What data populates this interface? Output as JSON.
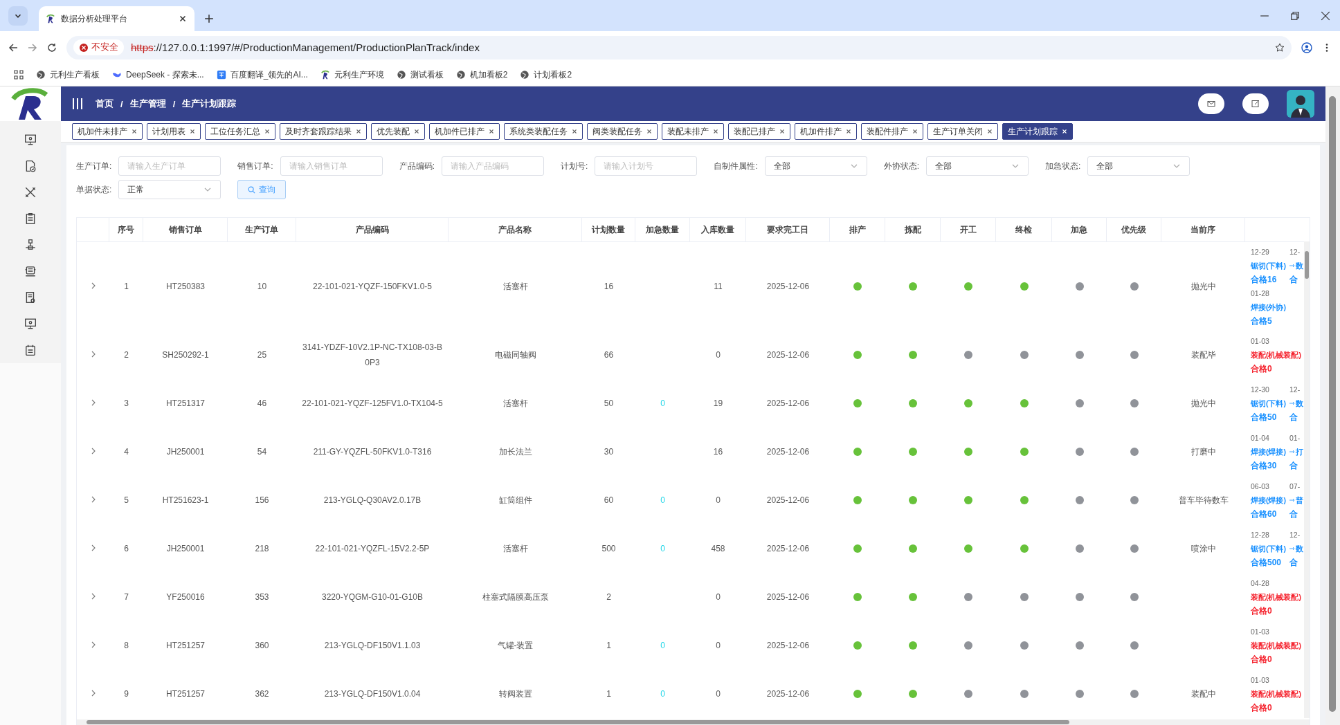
{
  "browser": {
    "tab_title": "数据分析处理平台",
    "insecure_label": "不安全",
    "url_scheme": "https",
    "url_rest": "://127.0.0.1:1997/#/ProductionManagement/ProductionPlanTrack/index",
    "bookmarks": [
      {
        "label": "元利生产看板",
        "kind": "globe"
      },
      {
        "label": "DeepSeek - 探索未...",
        "kind": "whale"
      },
      {
        "label": "百度翻译_领先的AI...",
        "kind": "translate"
      },
      {
        "label": "元利生产环境",
        "kind": "logo"
      },
      {
        "label": "测试看板",
        "kind": "globe"
      },
      {
        "label": "机加看板2",
        "kind": "globe"
      },
      {
        "label": "计划看板2",
        "kind": "globe"
      }
    ]
  },
  "sidebar": [
    {
      "kind": "monitor"
    },
    {
      "kind": "doc-check"
    },
    {
      "kind": "tools"
    },
    {
      "kind": "clipboard"
    },
    {
      "kind": "network"
    },
    {
      "kind": "machine"
    },
    {
      "kind": "doc-eye"
    },
    {
      "kind": "monitor"
    },
    {
      "kind": "calendar"
    }
  ],
  "header": {
    "breadcrumb": [
      "首页",
      "生产管理",
      "生产计划跟踪"
    ],
    "breadcrumb_separator": "/"
  },
  "tags": [
    {
      "label": "机加件未排产",
      "selected": false
    },
    {
      "label": "计划用表",
      "selected": false
    },
    {
      "label": "工位任务汇总",
      "selected": false
    },
    {
      "label": "及时齐套跟踪结果",
      "selected": false
    },
    {
      "label": "优先装配",
      "selected": false
    },
    {
      "label": "机加件已排产",
      "selected": false
    },
    {
      "label": "系统类装配任务",
      "selected": false
    },
    {
      "label": "阀类装配任务",
      "selected": false
    },
    {
      "label": "装配未排产",
      "selected": false
    },
    {
      "label": "装配已排产",
      "selected": false
    },
    {
      "label": "机加件排产",
      "selected": false
    },
    {
      "label": "装配件排产",
      "selected": false
    },
    {
      "label": "生产订单关闭",
      "selected": false
    },
    {
      "label": "生产计划跟踪",
      "selected": true
    }
  ],
  "filters": [
    {
      "label": "生产订单:",
      "kind": "input",
      "placeholder": "请输入生产订单"
    },
    {
      "label": "销售订单:",
      "kind": "input",
      "placeholder": "请输入销售订单"
    },
    {
      "label": "产品编码:",
      "kind": "input",
      "placeholder": "请输入产品编码"
    },
    {
      "label": "计划号:",
      "kind": "input",
      "placeholder": "请输入计划号"
    },
    {
      "label": "自制件属性:",
      "kind": "select",
      "value": "全部"
    },
    {
      "label": "外协状态:",
      "kind": "select",
      "value": "全部"
    },
    {
      "label": "加急状态:",
      "kind": "select",
      "value": "全部"
    },
    {
      "label": "单据状态:",
      "kind": "select",
      "value": "正常"
    }
  ],
  "query_button": "查询",
  "columns": [
    "序号",
    "销售订单",
    "生产订单",
    "产品编码",
    "产品名称",
    "计划数量",
    "加急数量",
    "入库数量",
    "要求完工日",
    "排产",
    "拣配",
    "开工",
    "终检",
    "加急",
    "优先级",
    "当前序"
  ],
  "rows": [
    {
      "index": "1",
      "sales_order": "HT250383",
      "production_order": "10",
      "product_code": "22-101-021-YQZF-150FKV1.0-5",
      "product_name": "活塞杆",
      "plan_qty": "16",
      "in_stock_qty": "11",
      "due_date": "2025-12-06",
      "dots": [
        {
          "on": true
        },
        {
          "on": true
        },
        {
          "on": true
        },
        {
          "on": true
        },
        {
          "on": false
        },
        {
          "on": false
        }
      ],
      "current_step": "抛光中",
      "process": [
        {
          "steps": [
            {
              "date": "12-29",
              "name": "锯切(下料)",
              "qty": "合格16",
              "alert": false
            },
            {
              "date": "12-",
              "name": "数",
              "qty": "合",
              "alert": false
            }
          ]
        },
        {
          "steps": [
            {
              "date": "01-28",
              "name": "焊接(外协)",
              "qty": "合格5",
              "alert": false
            }
          ]
        }
      ]
    },
    {
      "index": "2",
      "sales_order": "SH250292-1",
      "production_order": "25",
      "product_code": "3141-YDZF-10V2.1P-NC-TX108-03-B0P3",
      "product_name": "电磁同轴阀",
      "plan_qty": "66",
      "in_stock_qty": "0",
      "due_date": "2025-12-06",
      "dots": [
        {
          "on": true
        },
        {
          "on": true
        },
        {
          "on": false
        },
        {
          "on": false
        },
        {
          "on": false
        },
        {
          "on": false
        }
      ],
      "current_step": "装配毕",
      "process": [
        {
          "steps": [
            {
              "date": "01-03",
              "name": "装配(机械装配)",
              "qty": "合格0",
              "alert": true
            }
          ]
        }
      ]
    },
    {
      "index": "3",
      "sales_order": "HT251317",
      "production_order": "46",
      "product_code": "22-101-021-YQZF-125FV1.0-TX104-5",
      "product_name": "活塞杆",
      "plan_qty": "50",
      "urgent_qty": "0",
      "in_stock_qty": "19",
      "due_date": "2025-12-06",
      "dots": [
        {
          "on": true
        },
        {
          "on": true
        },
        {
          "on": true
        },
        {
          "on": true
        },
        {
          "on": false
        },
        {
          "on": false
        }
      ],
      "current_step": "抛光中",
      "process": [
        {
          "steps": [
            {
              "date": "12-30",
              "name": "锯切(下料)",
              "qty": "合格50",
              "alert": false
            },
            {
              "date": "12-",
              "name": "数",
              "qty": "合",
              "alert": false
            }
          ]
        }
      ]
    },
    {
      "index": "4",
      "sales_order": "JH250001",
      "production_order": "54",
      "product_code": "211-GY-YQZFL-50FKV1.0-T316",
      "product_name": "加长法兰",
      "plan_qty": "30",
      "in_stock_qty": "16",
      "due_date": "2025-12-06",
      "dots": [
        {
          "on": true
        },
        {
          "on": true
        },
        {
          "on": true
        },
        {
          "on": true
        },
        {
          "on": false
        },
        {
          "on": false
        }
      ],
      "current_step": "打磨中",
      "process": [
        {
          "steps": [
            {
              "date": "01-04",
              "name": "焊接(焊接)",
              "qty": "合格30",
              "alert": false
            },
            {
              "date": "01-",
              "name": "打",
              "qty": "合",
              "alert": false
            }
          ]
        }
      ]
    },
    {
      "index": "5",
      "sales_order": "HT251623-1",
      "production_order": "156",
      "product_code": "213-YGLQ-Q30AV2.0.17B",
      "product_name": "缸筒组件",
      "plan_qty": "60",
      "urgent_qty": "0",
      "in_stock_qty": "0",
      "due_date": "2025-12-06",
      "dots": [
        {
          "on": true
        },
        {
          "on": true
        },
        {
          "on": true
        },
        {
          "on": true
        },
        {
          "on": false
        },
        {
          "on": false
        }
      ],
      "current_step": "普车毕待数车",
      "process": [
        {
          "steps": [
            {
              "date": "06-03",
              "name": "焊接(焊接)",
              "qty": "合格60",
              "alert": false
            },
            {
              "date": "07-",
              "name": "普",
              "qty": "合",
              "alert": false
            }
          ]
        }
      ]
    },
    {
      "index": "6",
      "sales_order": "JH250001",
      "production_order": "218",
      "product_code": "22-101-021-YQZFL-15V2.2-5P",
      "product_name": "活塞杆",
      "plan_qty": "500",
      "urgent_qty": "0",
      "in_stock_qty": "458",
      "due_date": "2025-12-06",
      "dots": [
        {
          "on": true
        },
        {
          "on": true
        },
        {
          "on": true
        },
        {
          "on": true
        },
        {
          "on": false
        },
        {
          "on": false
        }
      ],
      "current_step": "喷涂中",
      "process": [
        {
          "steps": [
            {
              "date": "12-28",
              "name": "锯切(下料)",
              "qty": "合格500",
              "alert": false
            },
            {
              "date": "12-",
              "name": "数",
              "qty": "合",
              "alert": false
            }
          ]
        }
      ]
    },
    {
      "index": "7",
      "sales_order": "YF250016",
      "production_order": "353",
      "product_code": "3220-YQGM-G10-01-G10B",
      "product_name": "柱塞式隔膜高压泵",
      "plan_qty": "2",
      "in_stock_qty": "0",
      "due_date": "2025-12-06",
      "dots": [
        {
          "on": true
        },
        {
          "on": true
        },
        {
          "on": false
        },
        {
          "on": false
        },
        {
          "on": false
        },
        {
          "on": false
        }
      ],
      "process": [
        {
          "steps": [
            {
              "date": "04-28",
              "name": "装配(机械装配)",
              "qty": "合格0",
              "alert": true
            }
          ]
        }
      ]
    },
    {
      "index": "8",
      "sales_order": "HT251257",
      "production_order": "360",
      "product_code": "213-YGLQ-DF150V1.1.03",
      "product_name": "气罐-装置",
      "plan_qty": "1",
      "urgent_qty": "0",
      "in_stock_qty": "0",
      "due_date": "2025-12-06",
      "dots": [
        {
          "on": true
        },
        {
          "on": true
        },
        {
          "on": false
        },
        {
          "on": false
        },
        {
          "on": false
        },
        {
          "on": false
        }
      ],
      "process": [
        {
          "steps": [
            {
              "date": "01-03",
              "name": "装配(机械装配)",
              "qty": "合格0",
              "alert": true
            }
          ]
        }
      ]
    },
    {
      "index": "9",
      "sales_order": "HT251257",
      "production_order": "362",
      "product_code": "213-YGLQ-DF150V1.0.04",
      "product_name": "转阀装置",
      "plan_qty": "1",
      "urgent_qty": "0",
      "in_stock_qty": "0",
      "due_date": "2025-12-06",
      "dots": [
        {
          "on": true
        },
        {
          "on": true
        },
        {
          "on": false
        },
        {
          "on": false
        },
        {
          "on": false
        },
        {
          "on": false
        }
      ],
      "current_step": "装配中",
      "process": [
        {
          "steps": [
            {
              "date": "01-03",
              "name": "装配(机械装配)",
              "qty": "合格0",
              "alert": true
            }
          ]
        }
      ]
    }
  ]
}
